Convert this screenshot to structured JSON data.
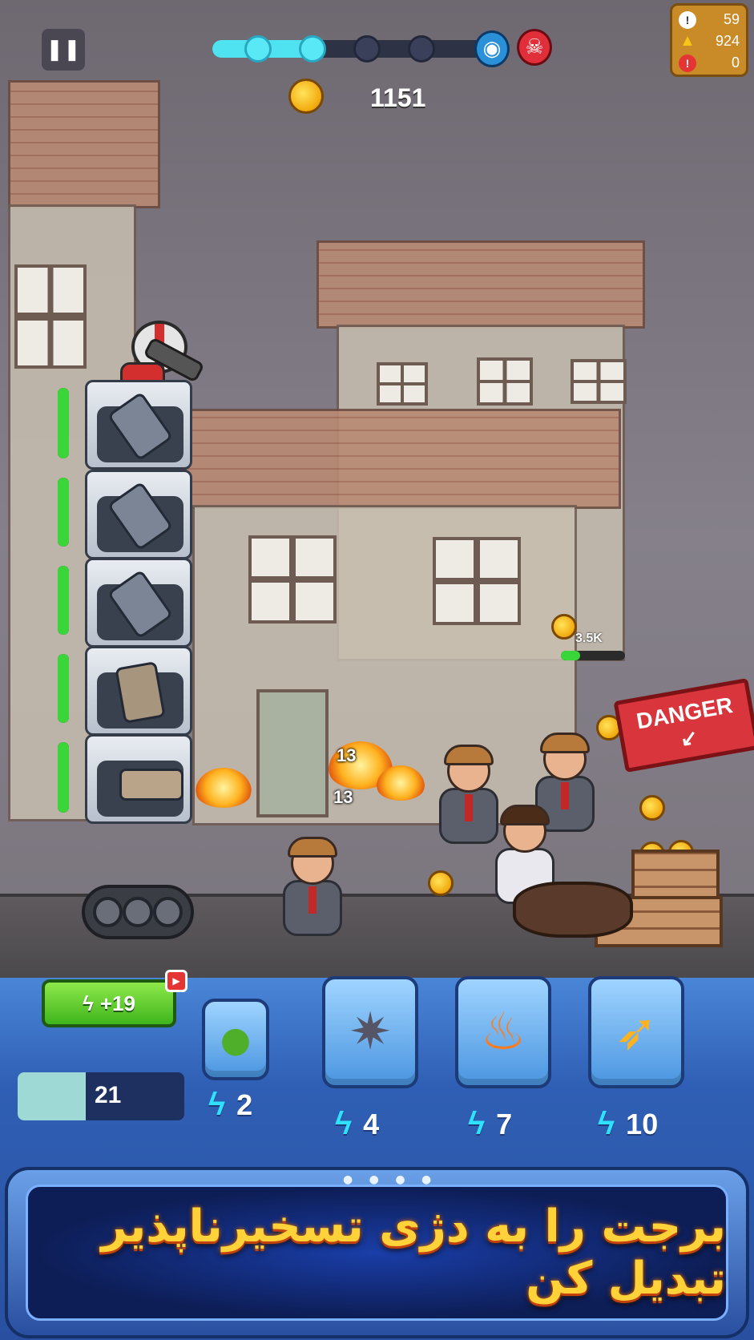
{
  "hud": {
    "pause_icon": "pause-icon",
    "wave_progress": 0.38,
    "wave_nodes_total": 5,
    "wave_nodes_done": 2,
    "coins": "1151",
    "stats": [
      {
        "icon": "exclamation-icon",
        "value": "59",
        "color": "#ffffff"
      },
      {
        "icon": "warning-icon",
        "value": "924",
        "color": "#f5c518"
      },
      {
        "icon": "alert-icon",
        "value": "0",
        "color": "#e53434"
      }
    ]
  },
  "battle": {
    "damage_numbers": [
      "13",
      "13"
    ],
    "boss_hp_label": "3.5K",
    "boss_hp_fraction": 0.3,
    "danger_sign": "DANGER",
    "tower_hp": [
      1.0,
      1.0,
      1.0,
      1.0,
      1.0
    ]
  },
  "controls": {
    "energy_bonus": "+19",
    "energy_value": "21",
    "energy_fraction": 0.41,
    "skills": [
      {
        "icon": "grenade-icon",
        "cost": "2"
      },
      {
        "icon": "sawblade-icon",
        "cost": "4"
      },
      {
        "icon": "fire-icon",
        "cost": "7"
      },
      {
        "icon": "missiles-icon",
        "cost": "10"
      }
    ]
  },
  "banner": {
    "text": "برجت را به دژی تسخیرناپذیر تبدیل کن"
  },
  "colors": {
    "accent": "#4fe3f2",
    "energy": "#3fb51d",
    "panel": "#2f5fb4",
    "banner_text": "#ffd23a"
  }
}
